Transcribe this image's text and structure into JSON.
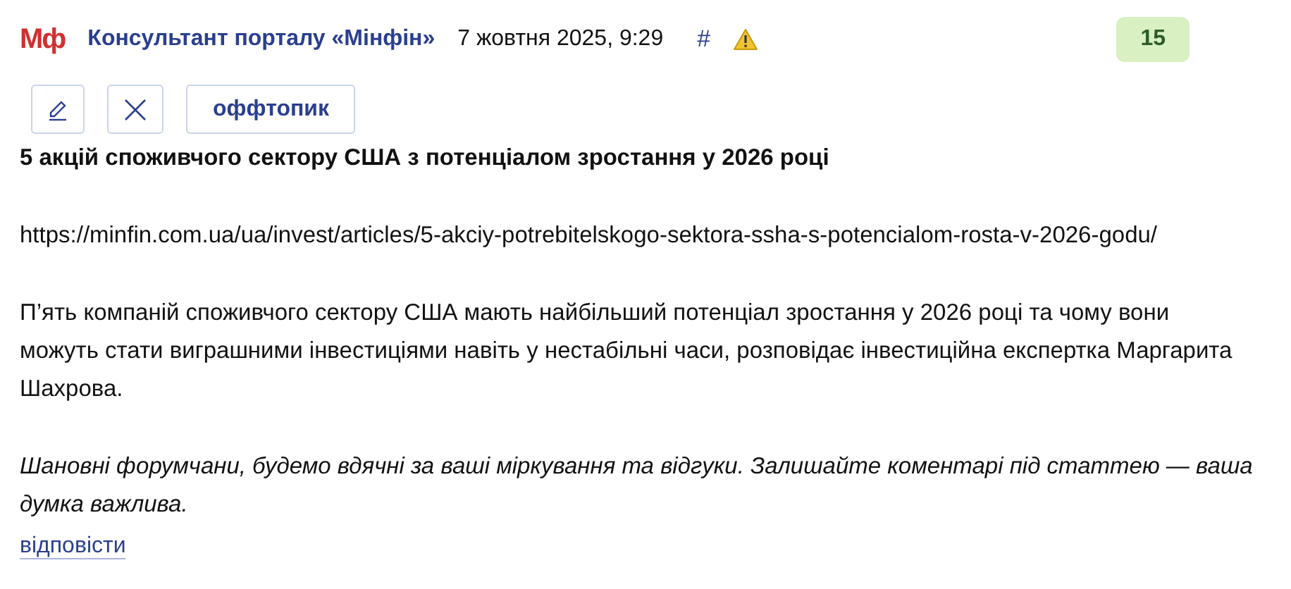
{
  "header": {
    "logo": "Мф",
    "author": "Консультант порталу «Мінфін»",
    "date": "7 жовтня 2025, 9:29",
    "hash": "#",
    "score": "15"
  },
  "actions": [
    {
      "kind": "edit"
    },
    {
      "kind": "delete"
    },
    {
      "kind": "label",
      "label": "оффтопик"
    }
  ],
  "post": {
    "title": "5 акцій споживчого сектору США з потенціалом зростання у 2026 році",
    "url": "https://minfin.com.ua/ua/invest/articles/5-akciy-potrebitelskogo-sektora-ssha-s-potencialom-rosta-v-2026-godu/",
    "body": "П’ять компаній споживчого сектору США мають найбільший потенціал зростання у 2026 році та чому вони можуть стати виграшними інвестиціями навіть у нестабільні часи, розповідає інвестиційна експертка Маргарита Шахрова.",
    "note": "Шановні форумчани, будемо вдячні за ваші міркування та відгуки. Залишайте коментарі під статтею — ваша думка важлива."
  },
  "reply_link": "відповісти"
}
